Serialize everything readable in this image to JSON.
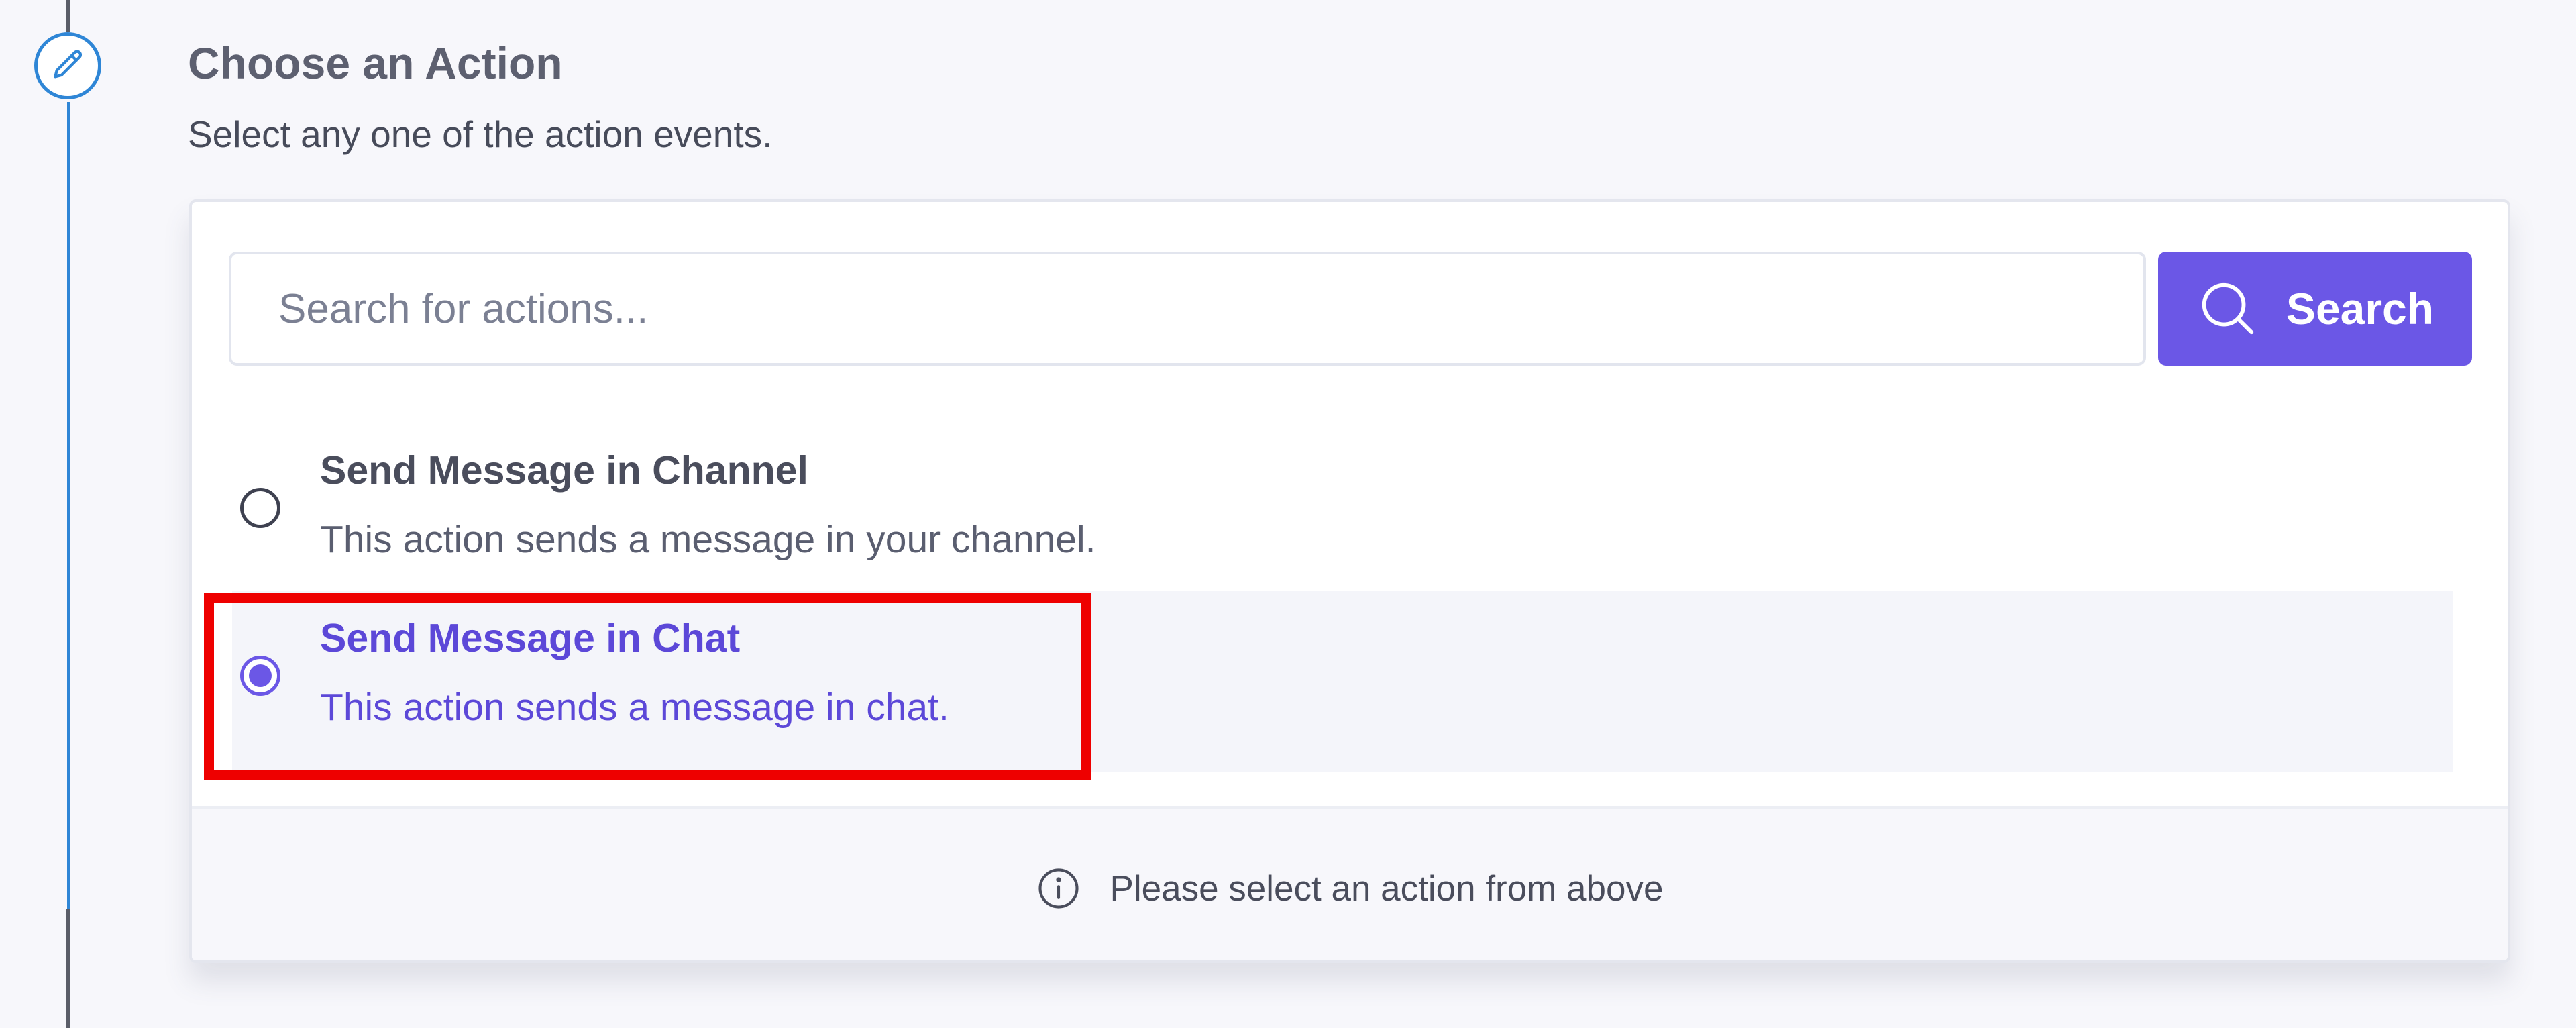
{
  "step": {
    "icon": "pencil-icon",
    "title": "Choose an Action",
    "subtitle": "Select any one of the action events."
  },
  "search": {
    "placeholder": "Search for actions...",
    "value": "",
    "button_label": "Search",
    "button_icon": "search-icon"
  },
  "actions": [
    {
      "title": "Send Message in Channel",
      "description": "This action sends a message in your channel.",
      "selected": false
    },
    {
      "title": "Send Message in Chat",
      "description": "This action sends a message in chat.",
      "selected": true
    }
  ],
  "footer": {
    "icon": "info-icon",
    "message": "Please select an action from above"
  },
  "colors": {
    "accent": "#6b57e6",
    "timeline": "#2f86d6",
    "highlight_outline": "#ee0000"
  }
}
